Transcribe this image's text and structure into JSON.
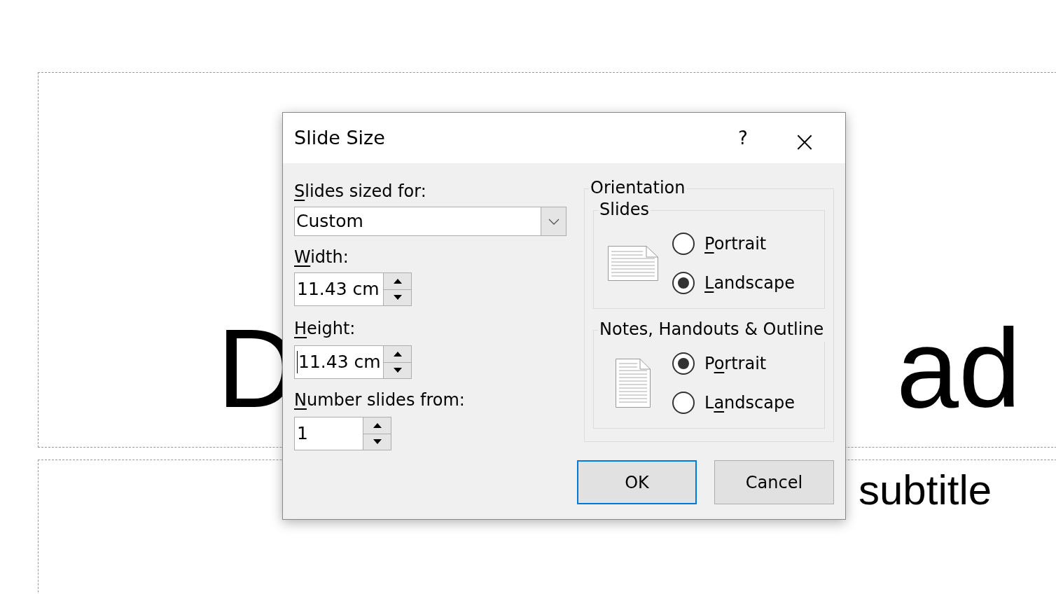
{
  "slide": {
    "title_fragments": [
      "D",
      "ad"
    ],
    "subtitle_fragment": "subtitle"
  },
  "dialog": {
    "title": "Slide Size",
    "help": "?",
    "close": "×",
    "sized_for": {
      "label": {
        "key": "S",
        "after": "lides sized for:"
      },
      "value": "Custom"
    },
    "width": {
      "label": {
        "key": "W",
        "after": "idth:"
      },
      "value": "11.43 cm"
    },
    "height": {
      "label": {
        "key": "H",
        "after": "eight:"
      },
      "value": "11.43 cm",
      "focused": true
    },
    "number_from": {
      "label": {
        "key": "N",
        "after": "umber slides from:"
      },
      "value": "1"
    },
    "orientation": {
      "title": "Orientation",
      "groups": [
        {
          "title": "Slides",
          "kind": "landscape",
          "options": [
            {
              "label": {
                "key": "P",
                "after": "ortrait"
              },
              "selected": false
            },
            {
              "label": {
                "key": "L",
                "after": "andscape"
              },
              "selected": true
            }
          ]
        },
        {
          "title": "Notes, Handouts & Outline",
          "kind": "portrait",
          "options": [
            {
              "label": {
                "before": "P",
                "key": "o",
                "after": "rtrait"
              },
              "selected": true
            },
            {
              "label": {
                "before": "L",
                "key": "a",
                "after": "ndscape"
              },
              "selected": false
            }
          ]
        }
      ]
    },
    "buttons": [
      {
        "label": "OK",
        "default": true
      },
      {
        "label": "Cancel",
        "default": false
      }
    ]
  }
}
